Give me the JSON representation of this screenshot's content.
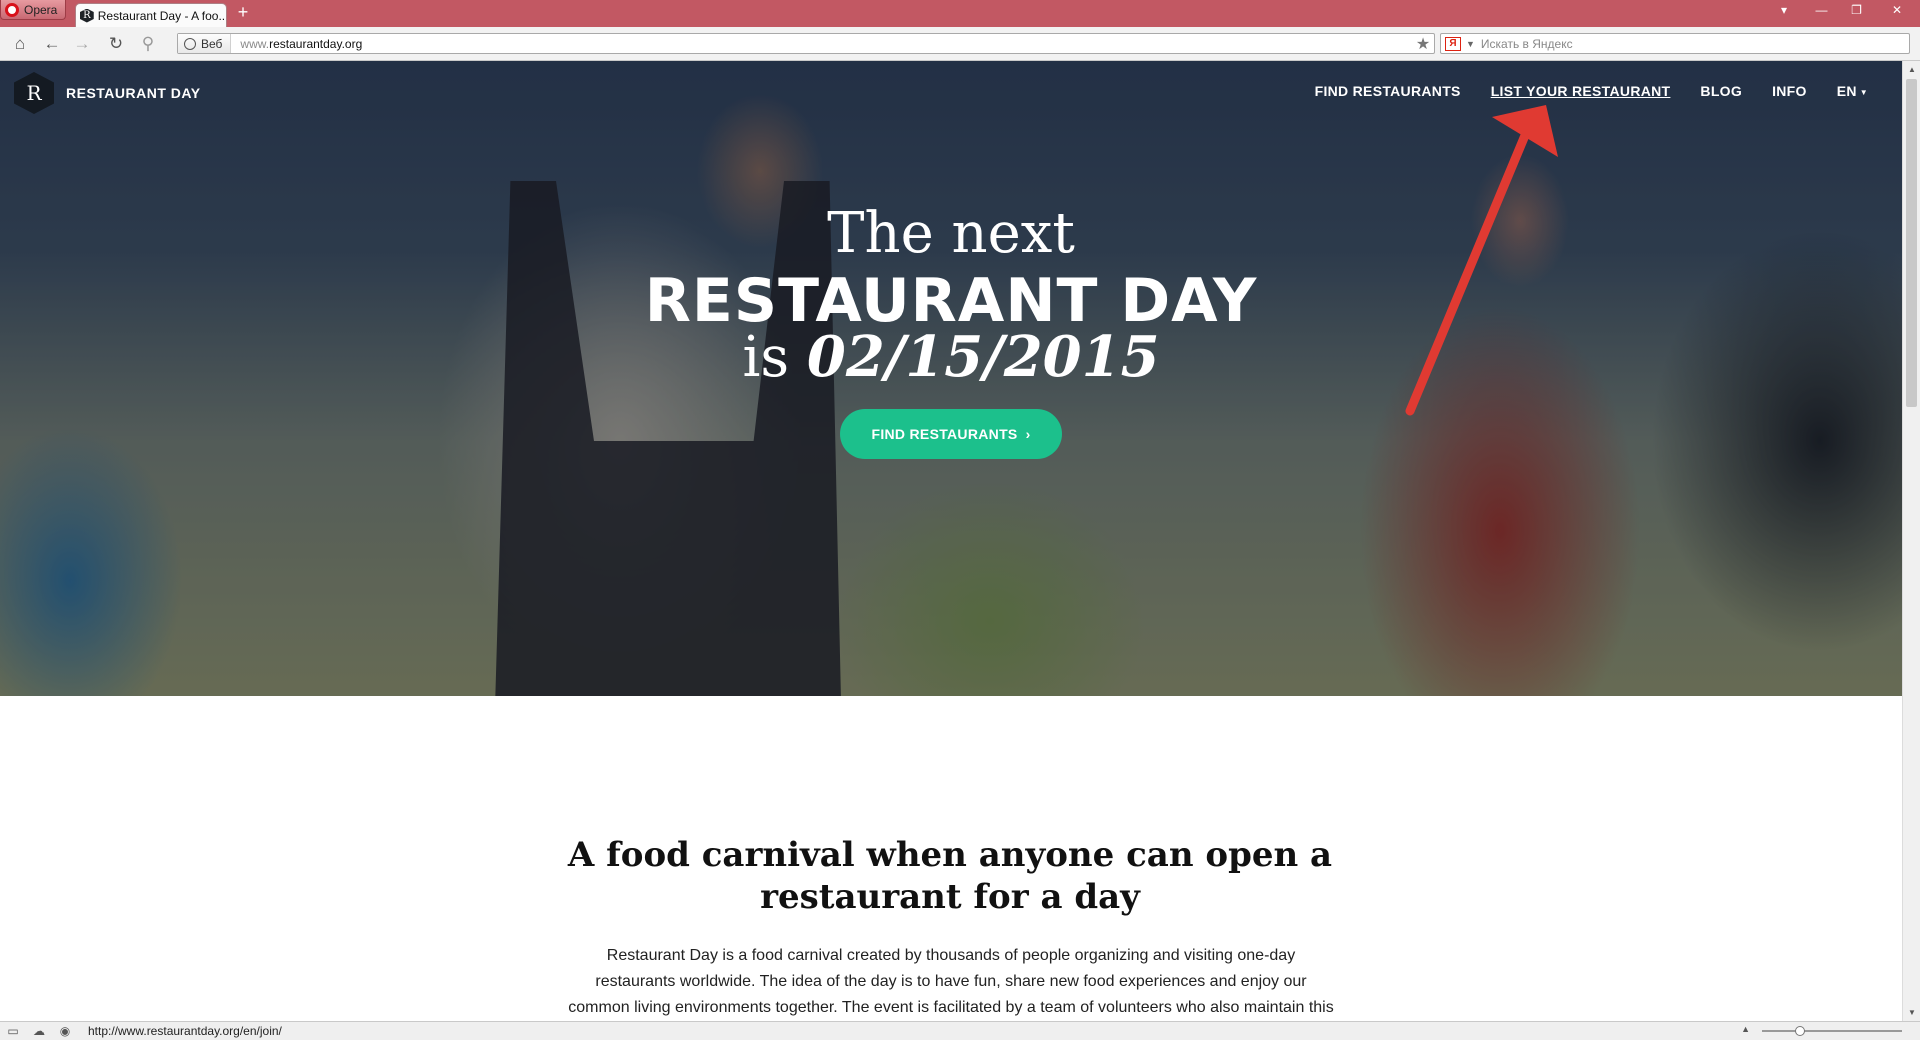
{
  "browser": {
    "menu_label": "Opera",
    "tab_title": "Restaurant Day - A foo...",
    "tab_favicon": "R",
    "new_tab": "+",
    "address": {
      "badge": "Веб",
      "url_prefix": "www.",
      "url_domain": "restaurantday.org"
    },
    "search_placeholder": "Искать в Яндекс",
    "search_engine_icon": "Я",
    "status_url": "http://www.restaurantday.org/en/join/",
    "zoom_level": 0.25
  },
  "site": {
    "logo_letter": "R",
    "brand": "RESTAURANT DAY",
    "nav": {
      "find": "FIND RESTAURANTS",
      "list": "LIST YOUR RESTAURANT",
      "blog": "BLOG",
      "info": "INFO",
      "lang": "EN"
    },
    "hero": {
      "line1": "The next",
      "line2": "RESTAURANT DAY",
      "line3_prefix": "is",
      "date": "02/15/2015",
      "cta": "FIND RESTAURANTS"
    },
    "intro": {
      "title": "A food carnival when anyone can open a restaurant for a day",
      "body": "Restaurant Day is a food carnival created by thousands of people organizing and visiting one-day restaurants worldwide. The idea of the day is to have fun, share new food experiences and enjoy our common living environments together. The event is facilitated by a team of volunteers who also maintain this website. All"
    }
  },
  "colors": {
    "tab_strip": "#c25863",
    "cta": "#1cc08c",
    "annotation_arrow": "#e03a32"
  },
  "icons": {
    "home": "home-icon",
    "back": "back-icon",
    "forward": "forward-icon",
    "reload": "reload-icon",
    "key": "key-icon",
    "star": "star-icon"
  }
}
